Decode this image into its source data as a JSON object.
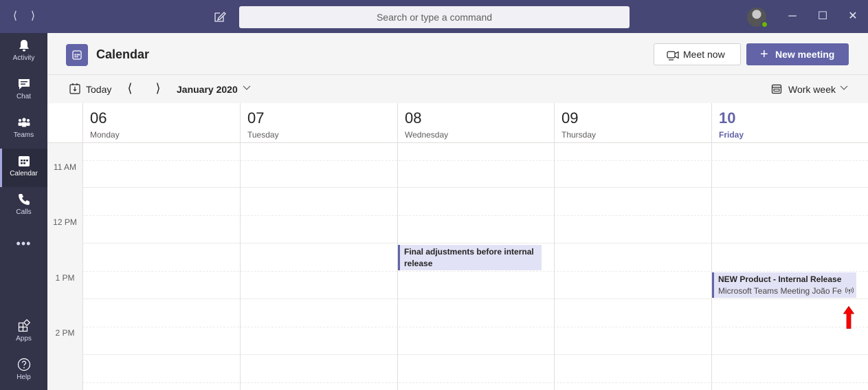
{
  "titlebar": {
    "search_placeholder": "Search or type a command",
    "back_icon": "chevron-left-icon",
    "forward_icon": "chevron-right-icon",
    "compose_icon": "compose-icon",
    "minimize": "─",
    "maximize": "☐",
    "close": "✕",
    "presence_color": "#6bb700"
  },
  "rail": {
    "items": [
      {
        "label": "Activity",
        "icon": "bell-icon"
      },
      {
        "label": "Chat",
        "icon": "chat-icon"
      },
      {
        "label": "Teams",
        "icon": "teams-icon"
      },
      {
        "label": "Calendar",
        "icon": "calendar-icon",
        "active": true
      },
      {
        "label": "Calls",
        "icon": "phone-icon"
      },
      {
        "label": "Apps",
        "icon": "apps-icon"
      },
      {
        "label": "Help",
        "icon": "help-icon"
      }
    ],
    "more": "•••"
  },
  "header": {
    "title": "Calendar",
    "meet_now": "Meet now",
    "new_meeting": "New meeting",
    "accent": "#6264a7"
  },
  "toolbar": {
    "today": "Today",
    "month": "January 2020",
    "view": "Work week"
  },
  "days": [
    {
      "num": "06",
      "name": "Monday"
    },
    {
      "num": "07",
      "name": "Tuesday"
    },
    {
      "num": "08",
      "name": "Wednesday"
    },
    {
      "num": "09",
      "name": "Thursday"
    },
    {
      "num": "10",
      "name": "Friday",
      "today": true
    }
  ],
  "times": [
    "11 AM",
    "12 PM",
    "1 PM",
    "2 PM"
  ],
  "events": [
    {
      "title": "Final adjustments before internal release",
      "day": "Wednesday"
    },
    {
      "title": "NEW Product - Internal Release",
      "subtitle": "Microsoft Teams Meeting  João Fe",
      "day": "Friday",
      "icon": "broadcast-icon"
    }
  ],
  "annotation": {
    "icon": "red-arrow-up-icon",
    "color": "#ff0000"
  }
}
